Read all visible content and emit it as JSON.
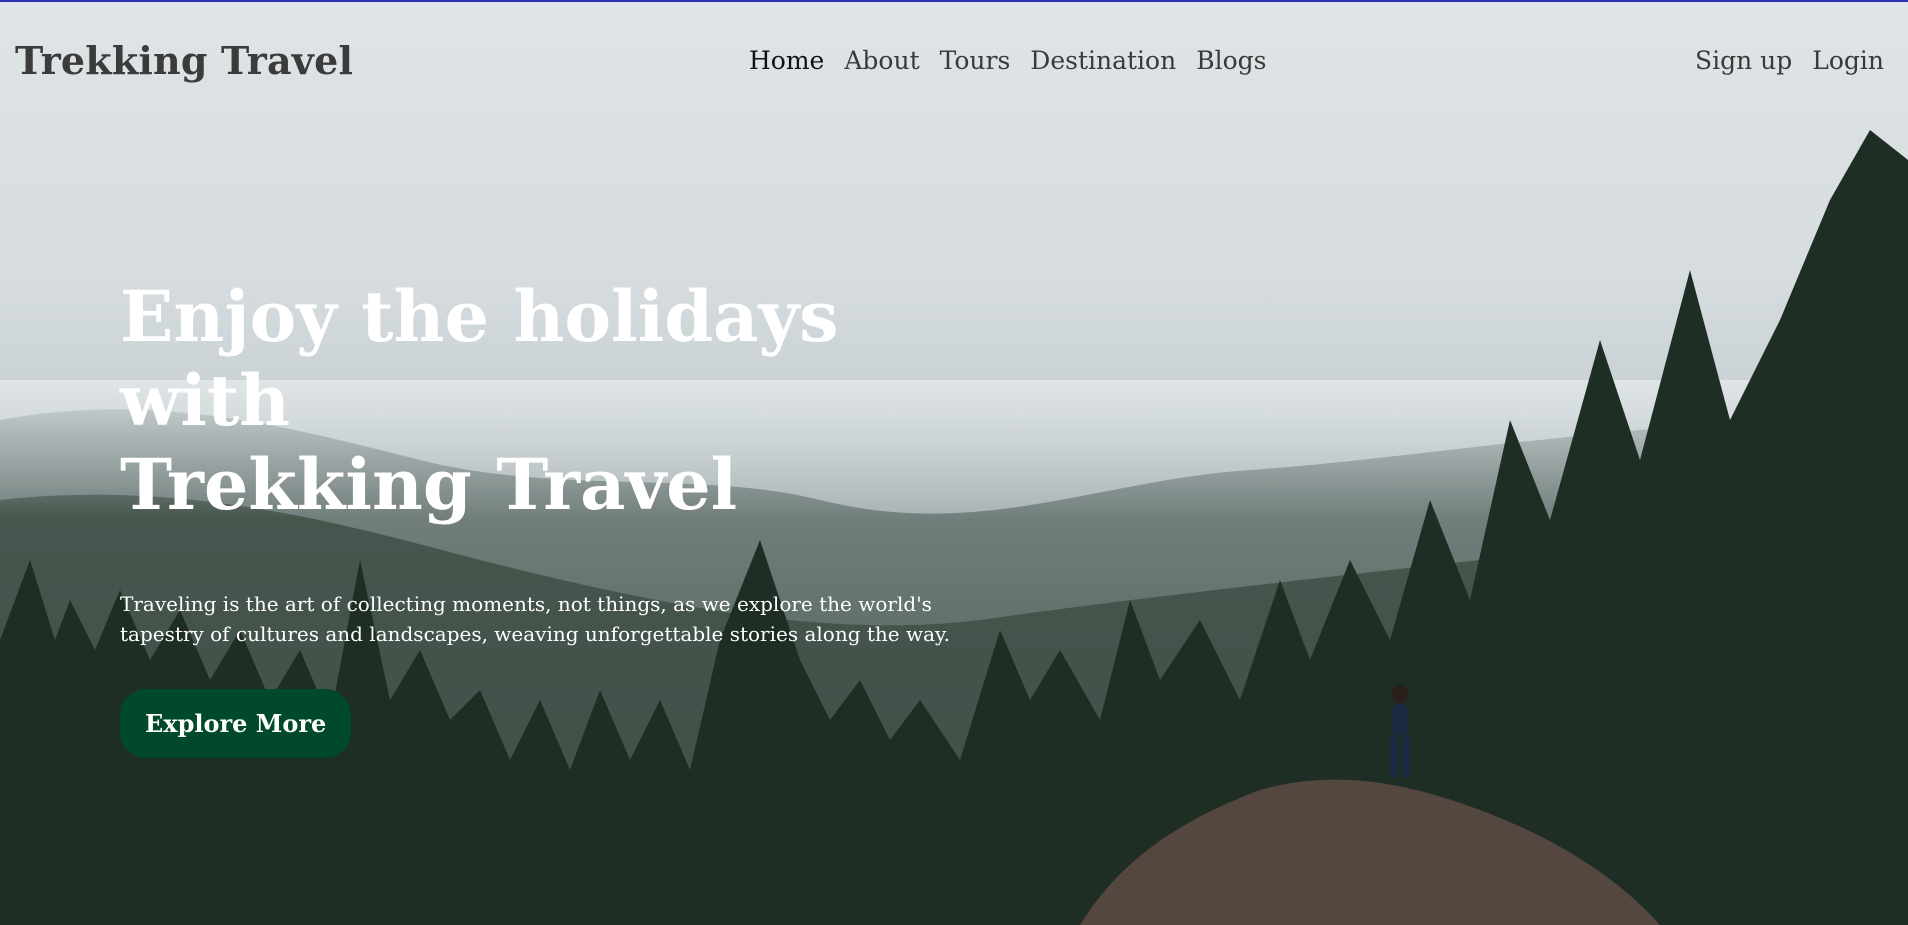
{
  "header": {
    "brand": "Trekking Travel",
    "nav": [
      {
        "label": "Home",
        "active": true
      },
      {
        "label": "About",
        "active": false
      },
      {
        "label": "Tours",
        "active": false
      },
      {
        "label": "Destination",
        "active": false
      },
      {
        "label": "Blogs",
        "active": false
      }
    ],
    "auth": {
      "signup_label": "Sign up",
      "login_label": "Login"
    }
  },
  "hero": {
    "title": "Enjoy the holidays with\nTrekking Travel",
    "text": "Traveling is the art of collecting moments, not things, as we explore the world's tapestry of cultures and landscapes, weaving unforgettable stories along the way.",
    "cta_label": "Explore More"
  },
  "colors": {
    "accent_bar": "#2f2fb3",
    "cta_background": "#00492a",
    "hero_text": "#ffffff",
    "header_text": "#3a3a3a"
  }
}
